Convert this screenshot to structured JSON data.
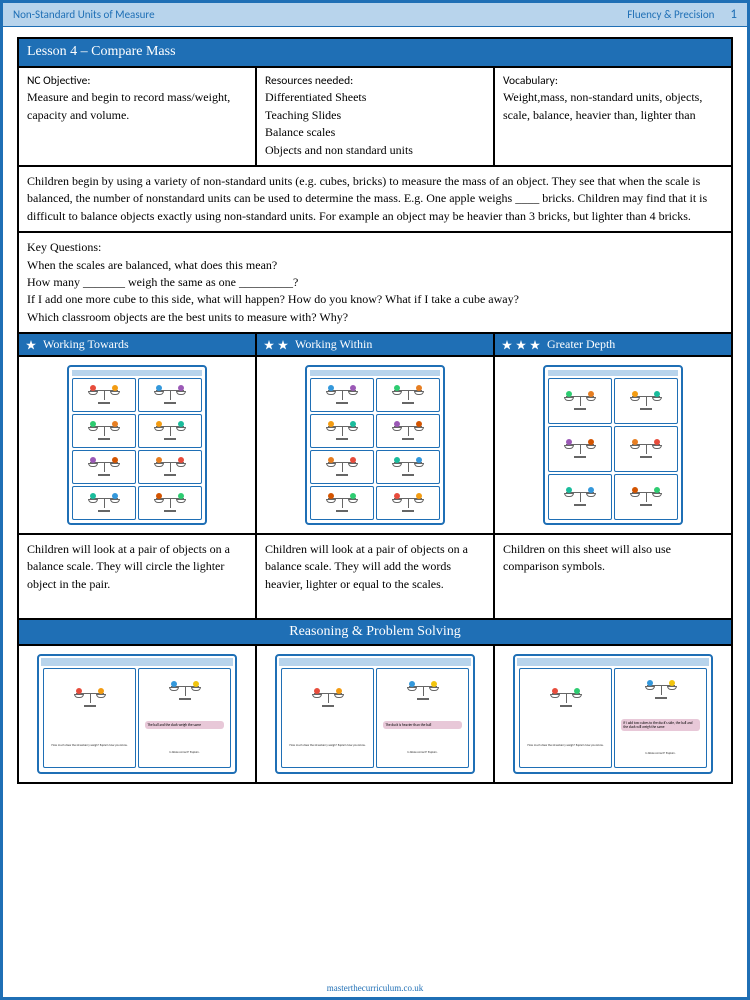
{
  "header": {
    "left": "Non-Standard Units of Measure",
    "right": "Fluency & Precision",
    "page": "1"
  },
  "lesson_title": "Lesson 4 – Compare Mass",
  "objective": {
    "h": "NC Objective:",
    "t": "Measure and begin to record mass/weight, capacity and volume."
  },
  "resources": {
    "h": "Resources needed:",
    "t": "Differentiated Sheets\nTeaching Slides\nBalance scales\nObjects and non standard units"
  },
  "vocab": {
    "h": "Vocabulary:",
    "t": "Weight,mass, non-standard units, objects, scale, balance, heavier than, lighter than"
  },
  "intro": "Children begin by using a variety of non-standard units (e.g. cubes, bricks) to measure the mass of an object. They see that when the scale is balanced, the number of nonstandard units can be used to determine the mass. E.g. One apple weighs ____ bricks. Children may find that it is difficult to balance objects exactly using non-standard units. For example an object may be heavier than 3 bricks, but lighter than 4 bricks.",
  "key_q": "Key Questions:\nWhen the scales are balanced, what does this mean?\nHow many _______ weigh the same as one _________?\nIf I add one more cube to this side, what will happen? How do you know? What if I take a cube away?\nWhich classroom objects are the best units to measure with? Why?",
  "diff": {
    "wt": {
      "label": "Working Towards",
      "desc": "Children will look at a pair of objects on a balance scale. They will circle the lighter object in the pair."
    },
    "ww": {
      "label": "Working Within",
      "desc": "Children will look at a pair of objects on a balance scale. They will add the words heavier, lighter or equal to the scales."
    },
    "gd": {
      "label": "Greater Depth",
      "desc": "Children on this sheet will also use comparison symbols."
    }
  },
  "rps_title": "Reasoning & Problem Solving",
  "footer": "masterthecurriculum.co.uk",
  "colors": [
    "#e74c3c",
    "#3498db",
    "#2ecc71",
    "#f39c12",
    "#9b59b6",
    "#e67e22",
    "#1abc9c",
    "#d35400"
  ]
}
